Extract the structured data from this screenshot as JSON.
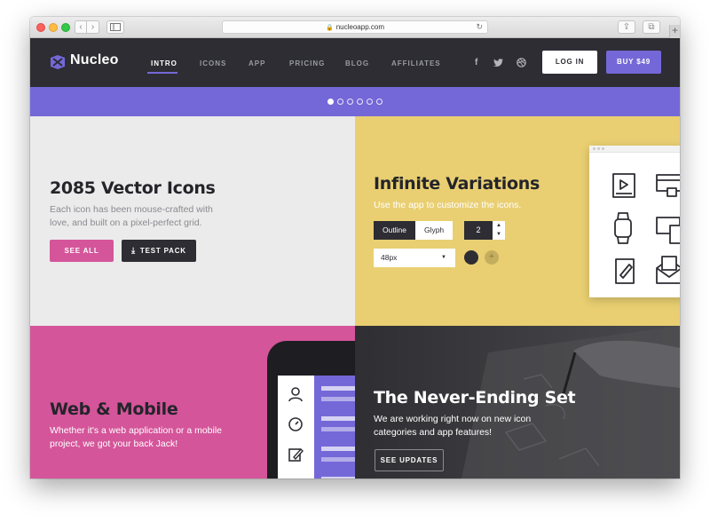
{
  "browser": {
    "url": "nucleoapp.com"
  },
  "header": {
    "brand": "Nucleo",
    "nav": [
      {
        "label": "INTRO",
        "active": true
      },
      {
        "label": "ICONS",
        "active": false
      },
      {
        "label": "APP",
        "active": false
      },
      {
        "label": "PRICING",
        "active": false
      },
      {
        "label": "BLOG",
        "active": false
      },
      {
        "label": "AFFILIATES",
        "active": false
      }
    ],
    "social": [
      "f",
      "twitter-icon",
      "dribbble-icon"
    ],
    "login_label": "LOG IN",
    "buy_label": "BUY $49"
  },
  "slider": {
    "dot_count": 6,
    "active_index": 0
  },
  "vector_icons": {
    "title": "2085 Vector Icons",
    "description": "Each icon has been mouse-crafted with love, and built on a pixel-perfect grid.",
    "see_all_label": "SEE ALL",
    "test_pack_label": "TEST PACK"
  },
  "variations": {
    "title": "Infinite Variations",
    "description": "Use the app to customize the icons.",
    "style_options": [
      "Outline",
      "Glyph"
    ],
    "selected_style": "Outline",
    "stroke_value": "2",
    "size_value": "48px"
  },
  "web_mobile": {
    "title": "Web & Mobile",
    "description": "Whether it's a web application or a mobile project, we got your back Jack!"
  },
  "never_ending": {
    "title": "The Never-Ending Set",
    "description": "We are working right now on new icon categories and app features!",
    "updates_label": "SEE UPDATES"
  },
  "colors": {
    "header_bg": "#2d2d33",
    "accent": "#7468d8",
    "pink": "#d4559a",
    "yellow": "#e9cf72",
    "light_gray": "#ebebeb",
    "dark_panel": "#3a3a3e"
  }
}
